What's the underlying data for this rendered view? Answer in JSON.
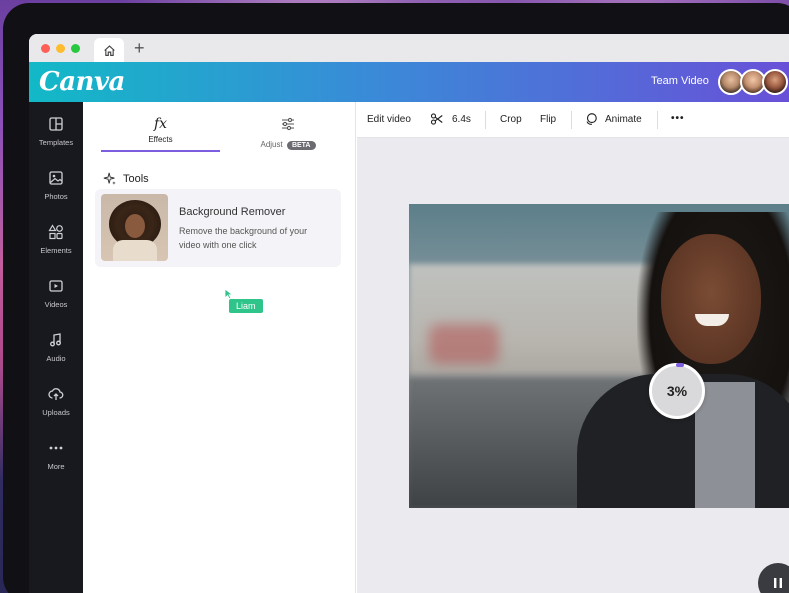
{
  "browser": {
    "home_icon": "home-icon",
    "new_tab_icon": "plus-icon",
    "new_tab_glyph": "+"
  },
  "header": {
    "logo": "Canva",
    "project_title": "Team Video",
    "collaborators": [
      "avatar-1",
      "avatar-2",
      "avatar-3"
    ]
  },
  "sidebar": {
    "items": [
      {
        "label": "Templates",
        "icon": "templates-icon"
      },
      {
        "label": "Photos",
        "icon": "photos-icon"
      },
      {
        "label": "Elements",
        "icon": "elements-icon"
      },
      {
        "label": "Videos",
        "icon": "videos-icon"
      },
      {
        "label": "Audio",
        "icon": "audio-icon"
      },
      {
        "label": "Uploads",
        "icon": "uploads-icon"
      },
      {
        "label": "More",
        "icon": "more-icon"
      }
    ]
  },
  "panel": {
    "tabs": [
      {
        "label": "Effects",
        "glyph": "fx",
        "active": true
      },
      {
        "label": "Adjust",
        "badge": "BETA",
        "active": false
      }
    ],
    "section_title": "Tools",
    "tool": {
      "name": "Background Remover",
      "description": "Remove the background of your video with one click"
    },
    "cursor_user": "Liam"
  },
  "toolbar": {
    "edit_video": "Edit video",
    "duration": "6.4s",
    "crop": "Crop",
    "flip": "Flip",
    "animate": "Animate",
    "more": "•••"
  },
  "canvas": {
    "progress_label": "3%",
    "progress_value": 3,
    "pause_icon": "pause-icon"
  },
  "colors": {
    "accent": "#7d5de0",
    "cursor_tag": "#2ec48a",
    "sidebar_bg": "#18191f"
  }
}
